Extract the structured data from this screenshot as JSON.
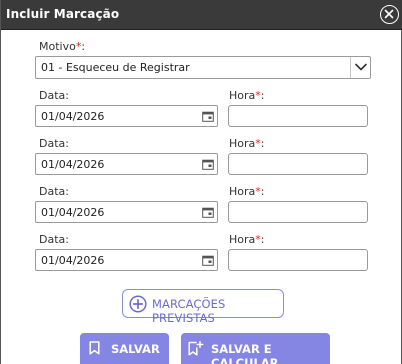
{
  "dialog": {
    "title": "Incluir Marcação"
  },
  "form": {
    "motivo_label": "Motivo",
    "required_mark": "*",
    "motivo_value": "01 - Esqueceu de Registrar",
    "rows": [
      {
        "data_label": "Data:",
        "data_value": "01/04/2026",
        "hora_label": "Hora",
        "hora_value": ""
      },
      {
        "data_label": "Data:",
        "data_value": "01/04/2026",
        "hora_label": "Hora",
        "hora_value": ""
      },
      {
        "data_label": "Data:",
        "data_value": "01/04/2026",
        "hora_label": "Hora",
        "hora_value": ""
      },
      {
        "data_label": "Data:",
        "data_value": "01/04/2026",
        "hora_label": "Hora",
        "hora_value": ""
      }
    ],
    "colon": ":"
  },
  "buttons": {
    "previstas_label": "MARCAÇÕES PREVISTAS",
    "salvar_label": "SALVAR",
    "salvar_calcular_label": "SALVAR E CALCULAR"
  },
  "icons": {
    "close": "close-circle-icon",
    "dropdown": "chevron-down-icon",
    "calendar": "calendar-icon",
    "plus": "plus-circle-icon",
    "bookmark": "bookmark-icon",
    "bookmark_plus": "bookmark-plus-icon"
  },
  "colors": {
    "titlebar": "#3a3a3a",
    "accent": "#8585e3",
    "required": "#e11b1b"
  }
}
